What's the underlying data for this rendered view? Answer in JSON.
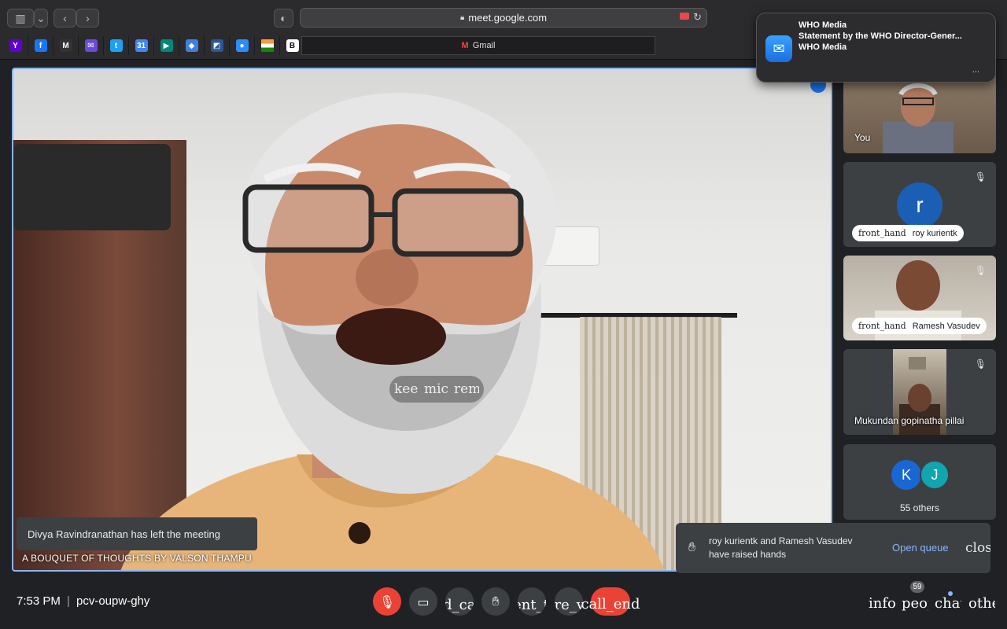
{
  "browser": {
    "url": "meet.google.com",
    "bookmark_tab_label": "Gmail",
    "bookmarks": [
      {
        "icon": "yahoo-icon",
        "glyph": "Y",
        "color": "#6001d2"
      },
      {
        "icon": "facebook-icon",
        "glyph": "f",
        "color": "#1877f2"
      },
      {
        "icon": "gmail-icon",
        "glyph": "M",
        "color": "#333333"
      },
      {
        "icon": "mail-icon",
        "glyph": "✉",
        "color": "#6b4bd8"
      },
      {
        "icon": "twitter-icon",
        "glyph": "t",
        "color": "#1da1f2"
      },
      {
        "icon": "calendar-icon",
        "glyph": "31",
        "color": "#4285f4"
      },
      {
        "icon": "meet-icon",
        "glyph": "▶",
        "color": "#00897b"
      },
      {
        "icon": "maps-icon",
        "glyph": "◆",
        "color": "#3f7fe0"
      },
      {
        "icon": "chart-icon",
        "glyph": "◩",
        "color": "#2b5797"
      },
      {
        "icon": "zoom-icon",
        "glyph": "●",
        "color": "#2d8cff"
      },
      {
        "icon": "india-flag-icon",
        "glyph": "",
        "color": "#ff9933"
      },
      {
        "icon": "b-icon",
        "glyph": "B",
        "color": "#ffffff"
      }
    ]
  },
  "notification": {
    "app": "WHO Media",
    "subject": "Statement by the WHO Director-Gener...",
    "sender": "WHO Media",
    "more": "..."
  },
  "main_video": {
    "caption_partial": [
      "kee",
      "mic",
      "rem"
    ],
    "toast": "Divya Ravindranathan has left the meeting",
    "name": "A BOUQUET OF THOUGHTS BY VALSON THAMPU"
  },
  "tiles": {
    "you": "You",
    "roy": {
      "avatar": "r",
      "hand": "front_hand",
      "name": "roy kurientk"
    },
    "ramesh": {
      "hand": "front_hand",
      "name": "Ramesh Vasudev"
    },
    "mukund": {
      "name": "Mukundan gopinatha pillai"
    },
    "others": {
      "k": "K",
      "j": "J",
      "label": "55 others"
    }
  },
  "hands_toast": {
    "message": "roy kurientk and Ramesh Vasudev have raised hands",
    "open_queue": "Open queue",
    "close": "close"
  },
  "bottom_bar": {
    "time": "7:53 PM",
    "separator": "|",
    "meeting_code": "pcv-oupw-ghy",
    "captions": "closed_caption",
    "present": "present_to_all",
    "more": "more_vert",
    "call_end": "call_end",
    "info": "info",
    "people": "people",
    "people_count": "59",
    "chat": "chat",
    "activities": "other"
  },
  "colors": {
    "accent_blue": "#8ab4f8",
    "red": "#ea4335",
    "tile_bg": "#3c4043",
    "bar_bg": "#202124"
  }
}
